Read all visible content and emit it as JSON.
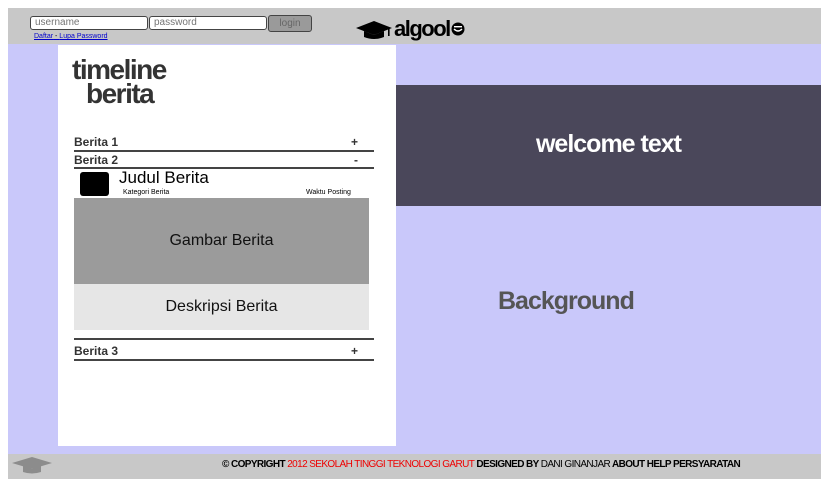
{
  "header": {
    "username_placeholder": "username",
    "password_placeholder": "password",
    "login_label": "login",
    "register_label": "Daftar",
    "link_separator": " - ",
    "forgot_label": "Lupa Password",
    "logo_text": "algool"
  },
  "timeline": {
    "title_line1": "timeline",
    "title_line2": "berita",
    "items": [
      {
        "label": "Berita 1",
        "toggle": "+"
      },
      {
        "label": "Berita 2",
        "toggle": "-"
      },
      {
        "label": "Berita 3",
        "toggle": "+"
      }
    ],
    "expanded": {
      "title": "Judul Berita",
      "category": "Kategori Berita",
      "time": "Waktu Posting",
      "image_label": "Gambar Berita",
      "description_label": "Deskripsi Berita"
    }
  },
  "main": {
    "welcome_text": "welcome text",
    "background_label": "Background"
  },
  "footer": {
    "copyright": "© COPYRIGHT",
    "year_org": "2012 SEKOLAH TINGGI TEKNOLOGI GARUT",
    "designed_by": "DESIGNED BY",
    "designer": "DANI GINANJAR",
    "about": "ABOUT",
    "help": "HELP",
    "terms": "PERSYARATAN"
  },
  "colors": {
    "background": "#c9c8fa",
    "bars": "#c8c8c8",
    "welcome_bg": "#4a475a",
    "image_placeholder": "#9b9b9b",
    "description_placeholder": "#e6e6e6",
    "footer_highlight": "#ee0000"
  },
  "icons": [
    "mortarboard-icon",
    "smiley-icon",
    "mortarboard-footer-icon"
  ]
}
